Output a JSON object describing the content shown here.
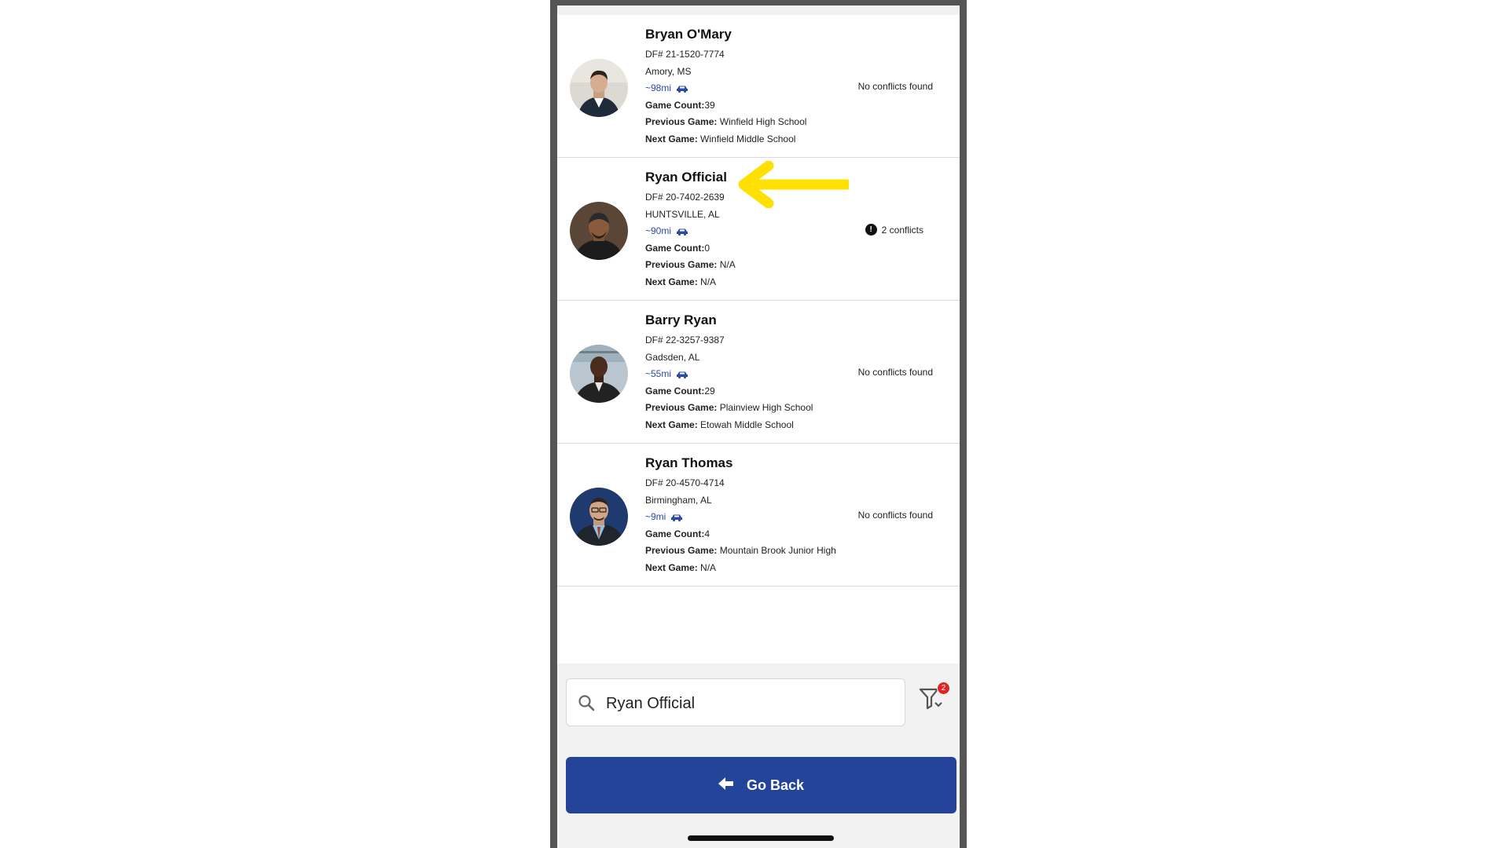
{
  "officials": [
    {
      "name": "Bryan O'Mary",
      "df": "DF# 21-1520-7774",
      "location": "Amory, MS",
      "distance": "~98mi",
      "game_count_label": "Game Count:",
      "game_count": "39",
      "previous_label": "Previous Game:",
      "previous": "Winfield High School",
      "next_label": "Next Game:",
      "next": "Winfield Middle School",
      "conflicts": "No conflicts found",
      "has_conflict": false
    },
    {
      "name": "Ryan Official",
      "df": "DF# 20-7402-2639",
      "location": "HUNTSVILLE, AL",
      "distance": "~90mi",
      "game_count_label": "Game Count:",
      "game_count": "0",
      "previous_label": "Previous Game:",
      "previous": "N/A",
      "next_label": "Next Game:",
      "next": "N/A",
      "conflicts": "2 conflicts",
      "has_conflict": true,
      "conflict_icon": "!"
    },
    {
      "name": "Barry Ryan",
      "df": "DF# 22-3257-9387",
      "location": "Gadsden, AL",
      "distance": "~55mi",
      "game_count_label": "Game Count:",
      "game_count": "29",
      "previous_label": "Previous Game:",
      "previous": "Plainview High School",
      "next_label": "Next Game:",
      "next": "Etowah Middle School",
      "conflicts": "No conflicts found",
      "has_conflict": false
    },
    {
      "name": "Ryan Thomas",
      "df": "DF# 20-4570-4714",
      "location": "Birmingham, AL",
      "distance": "~9mi",
      "game_count_label": "Game Count:",
      "game_count": "4",
      "previous_label": "Previous Game:",
      "previous": "Mountain Brook Junior High",
      "next_label": "Next Game:",
      "next": "N/A",
      "conflicts": "No conflicts found",
      "has_conflict": false
    }
  ],
  "search": {
    "value": "Ryan Official"
  },
  "filter": {
    "badge": "2"
  },
  "go_back": {
    "label": "Go Back"
  },
  "colors": {
    "accent": "#24449a",
    "distance": "#2b4aa0",
    "badge": "#e02424",
    "annotation_arrow": "#ffe000"
  }
}
